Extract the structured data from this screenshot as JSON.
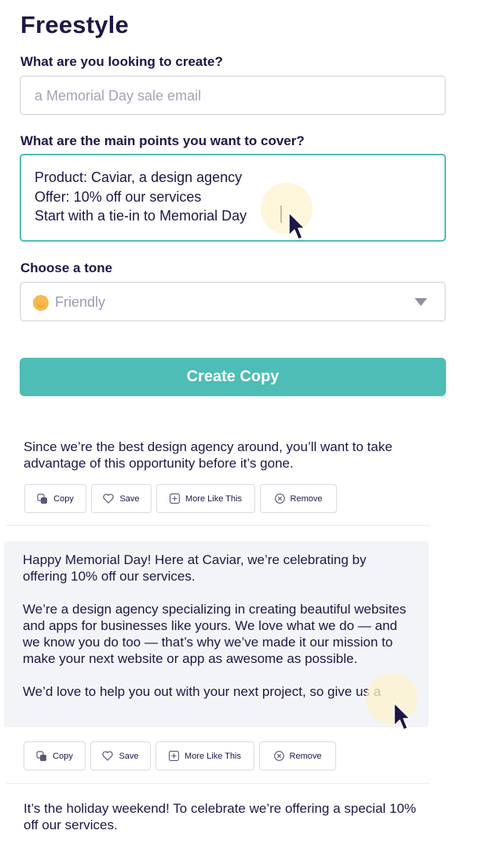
{
  "page": {
    "title": "Freestyle"
  },
  "form": {
    "what_label": "What are you looking to create?",
    "what_placeholder": "a Memorial Day sale email",
    "points_label": "What are the main points you want to cover?",
    "points_lines": [
      "Product: Caviar, a design agency",
      "Offer: 10% off our services",
      "Start with a tie-in to Memorial Day"
    ],
    "tone_label": "Choose a tone",
    "tone_value": "Friendly",
    "tone_icon": "smiley-face-icon",
    "create_button": "Create Copy"
  },
  "actions": {
    "copy": "Copy",
    "save": "Save",
    "more": "More Like This",
    "remove": "Remove"
  },
  "results": [
    {
      "paragraphs": [
        "Since we’re the best design agency around, you’ll want to take advantage of this opportunity before it’s gone."
      ]
    },
    {
      "paragraphs": [
        "Happy Memorial Day! Here at Caviar, we’re celebrating by offering 10% off our services.",
        "We’re a design agency specializing in creating beautiful websites and apps for businesses like yours. We love what we do — and we know you do too — that’s why we’ve made it our mission to make your next website or app as awesome as possible.",
        "We’d love to help you out with your next project, so give us a"
      ]
    },
    {
      "paragraphs": [
        "It’s the holiday weekend! To celebrate we’re offering a special 10% off our services."
      ]
    }
  ],
  "colors": {
    "accent": "#4dbdb5",
    "text": "#1f1646",
    "placeholder": "#a4a4b4",
    "panel": "#f3f4f7"
  }
}
